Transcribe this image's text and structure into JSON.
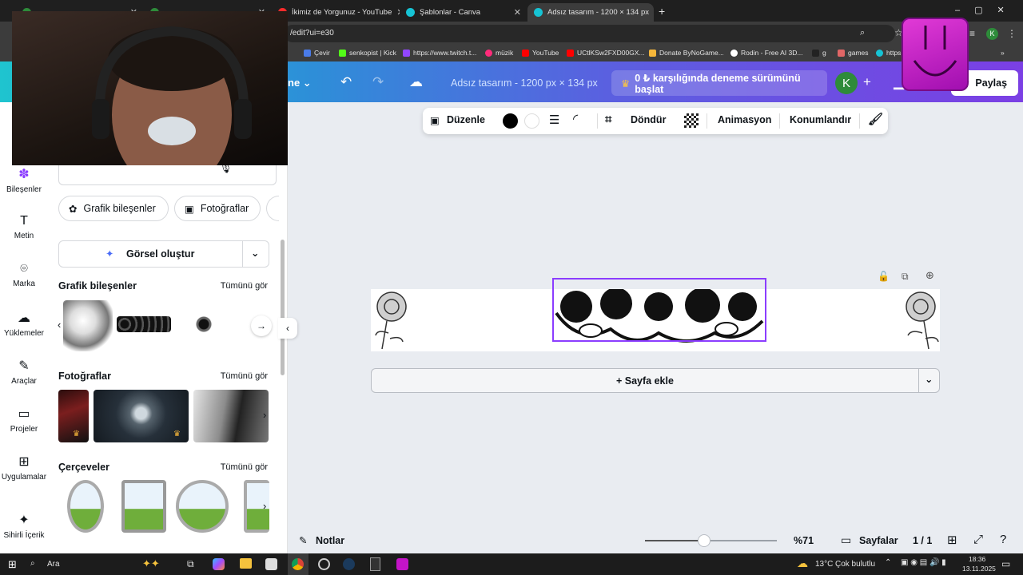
{
  "browser": {
    "tabs": [
      {
        "title": "",
        "color": "#2e8b3a"
      },
      {
        "title": "",
        "color": "#2e8b3a"
      },
      {
        "title": "İkimiz de Yorgunuz - YouTube",
        "color": "#ff2b2b"
      },
      {
        "title": "Şablonlar - Canva",
        "color": "#16c3d4"
      },
      {
        "title": "Adsız tasarım - 1200 × 134 px",
        "color": "#16c3d4"
      }
    ],
    "new_tab": "+",
    "url": "/edit?ui=e30",
    "bookmarks": [
      "Çevir",
      "senkopist | Kick",
      "https://www.twitch.t...",
      "müzik",
      "YouTube",
      "UCtlKSw2FXD00GX...",
      "Donate ByNoGame...",
      "Rodin - Free AI 3D...",
      "g",
      "games",
      "https"
    ],
    "profile_letter": "K"
  },
  "canva": {
    "menu_fragment": "ne",
    "doc_title": "Adsız tasarım - 1200 px × 134 px",
    "trial_label": "0 ₺ karşılığında deneme sürümünü başlat",
    "avatar_letter": "K",
    "share_label": "Paylaş",
    "accent": "#8b3dff"
  },
  "rail": {
    "items": [
      {
        "label": "Bileşenler",
        "icon": "elements-icon"
      },
      {
        "label": "Metin",
        "icon": "text-icon"
      },
      {
        "label": "Marka",
        "icon": "brand-icon"
      },
      {
        "label": "Yüklemeler",
        "icon": "upload-icon"
      },
      {
        "label": "Araçlar",
        "icon": "tools-icon"
      },
      {
        "label": "Projeler",
        "icon": "folder-icon"
      },
      {
        "label": "Uygulamalar",
        "icon": "apps-icon"
      },
      {
        "label": "Sihirli İçerik",
        "icon": "magic-icon"
      }
    ]
  },
  "panel": {
    "chips": [
      "Grafik bileşenler",
      "Fotoğraflar"
    ],
    "generate_label": "Görsel oluştur",
    "sections": [
      {
        "title": "Grafik bileşenler",
        "see_all": "Tümünü gör"
      },
      {
        "title": "Fotoğraflar",
        "see_all": "Tümünü gör"
      },
      {
        "title": "Çerçeveler",
        "see_all": "Tümünü gör"
      }
    ]
  },
  "toolbar": {
    "edit": "Düzenle",
    "rotate": "Döndür",
    "animate": "Animasyon",
    "position": "Konumlandır"
  },
  "canvas": {
    "add_page": "+ Sayfa ekle"
  },
  "bottom": {
    "notes": "Notlar",
    "zoom": "%71",
    "zoom_level": 0.45,
    "pages_label": "Sayfalar",
    "page_count": "1 / 1"
  },
  "taskbar": {
    "search": "Ara",
    "weather_temp": "13°C",
    "weather_text": "Çok bulutlu",
    "time": "18:36",
    "date": "13.11.2025"
  }
}
